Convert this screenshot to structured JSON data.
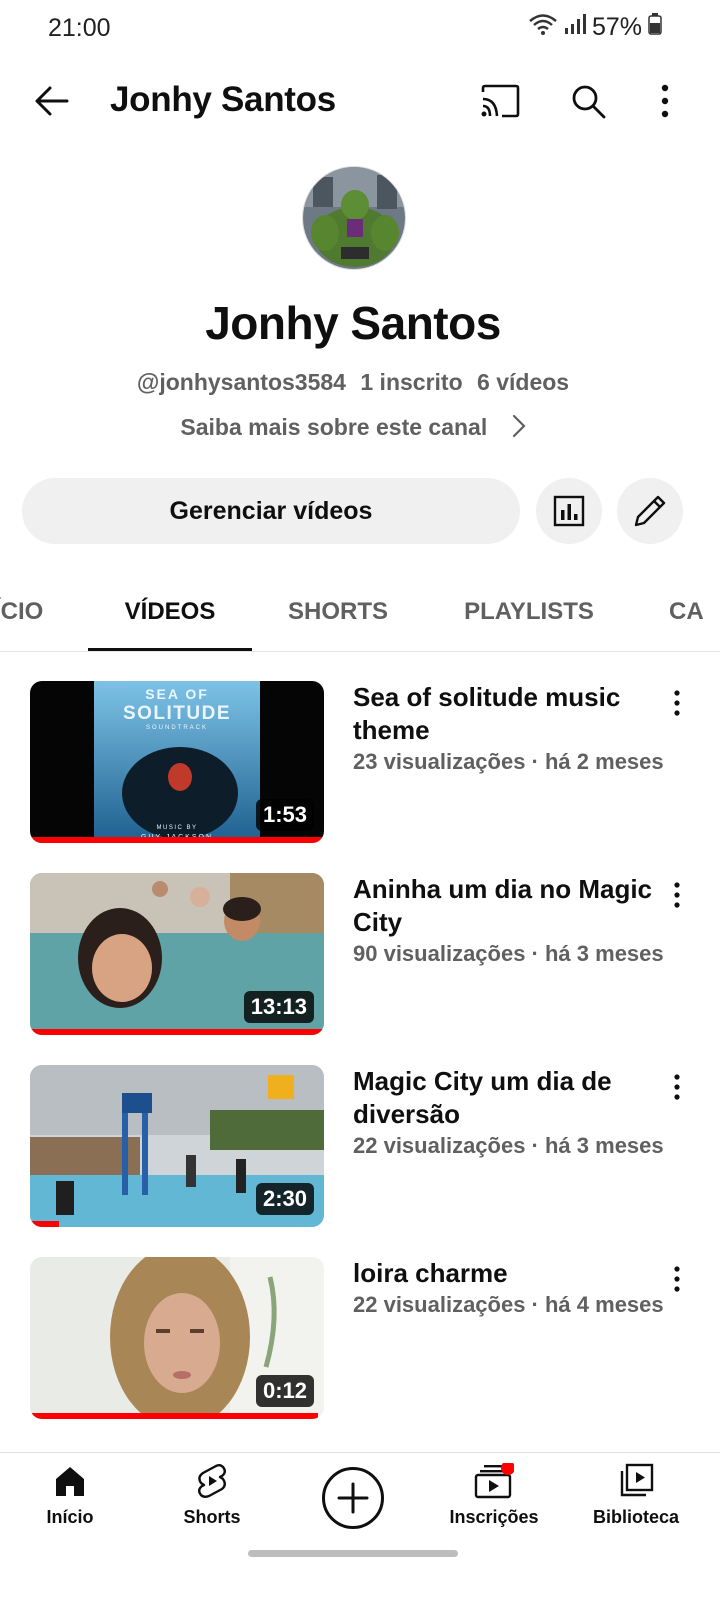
{
  "status_bar": {
    "time": "21:00",
    "battery": "57%"
  },
  "app_bar": {
    "title": "Jonhy Santos"
  },
  "channel": {
    "name": "Jonhy Santos",
    "handle": "@jonhysantos3584",
    "subscribers": "1 inscrito",
    "video_count": "6 vídeos",
    "about_link": "Saiba mais sobre este canal",
    "manage_button": "Gerenciar vídeos"
  },
  "tabs": [
    "ÍCIO",
    "VÍDEOS",
    "SHORTS",
    "PLAYLISTS",
    "CA"
  ],
  "videos": [
    {
      "title": "Sea of solitude music theme",
      "meta": "23 visualizações · há 2 meses",
      "duration": "1:53",
      "progress": 1.0
    },
    {
      "title": "Aninha um dia no Magic City",
      "meta": "90 visualizações · há 3 meses",
      "duration": "13:13",
      "progress": 1.0
    },
    {
      "title": "Magic City um dia de diversão",
      "meta": "22 visualizações · há 3 meses",
      "duration": "2:30",
      "progress": 0.1
    },
    {
      "title": "loira charme",
      "meta": "22 visualizações · há 4 meses",
      "duration": "0:12",
      "progress": 0.98
    }
  ],
  "thumbnail_text": {
    "sea_of": "SEA OF",
    "solitude": "SOLITUDE",
    "soundtrack": "SOUNDTRACK",
    "music_by": "MUSIC BY",
    "composer": "GUY JACKSON"
  },
  "bottom_nav": {
    "home": "Início",
    "shorts": "Shorts",
    "subscriptions": "Inscrições",
    "library": "Biblioteca"
  },
  "colors": {
    "accent": "#ff0000",
    "chip_bg": "#f0f0f0",
    "secondary_text": "#606060"
  }
}
